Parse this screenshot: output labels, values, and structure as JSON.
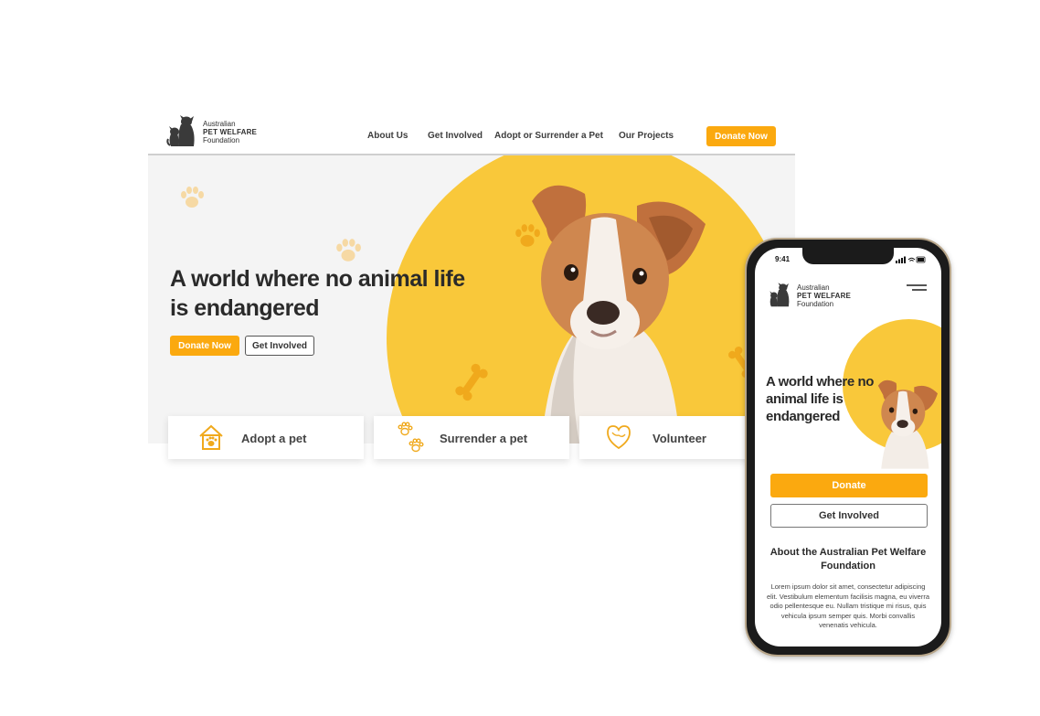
{
  "colors": {
    "accent": "#fba90f",
    "hero_yellow": "#f9c83a",
    "hero_bg": "#f4f4f4",
    "text_dark": "#2a2a2a",
    "logo_gray": "#3a3a3a"
  },
  "brand": {
    "line1": "Australian",
    "line2": "PET WELFARE",
    "line3": "Foundation"
  },
  "desktop": {
    "nav": [
      "About Us",
      "Get Involved",
      "Adopt or Surrender a Pet",
      "Our Projects"
    ],
    "donate_label": "Donate Now",
    "hero": {
      "title": "A world where no animal life is endangered",
      "donate_label": "Donate Now",
      "involved_label": "Get Involved"
    },
    "cards": [
      {
        "label": "Adopt a pet",
        "icon": "house-paw-icon"
      },
      {
        "label": "Surrender a pet",
        "icon": "paw-prints-icon"
      },
      {
        "label": "Volunteer",
        "icon": "heart-hands-icon"
      }
    ]
  },
  "mobile": {
    "time": "9:41",
    "hero_title": "A world where no animal life is endangered",
    "donate_label": "Donate",
    "involved_label": "Get Involved",
    "about_title": "About the Australian Pet Welfare Foundation",
    "about_body": "Lorem ipsum dolor sit amet, consectetur adipiscing elit. Vestibulum elementum facilisis magna, eu viverra odio pellentesque eu. Nullam tristique mi risus, quis vehicula ipsum semper quis. Morbi convallis venenatis vehicula."
  }
}
